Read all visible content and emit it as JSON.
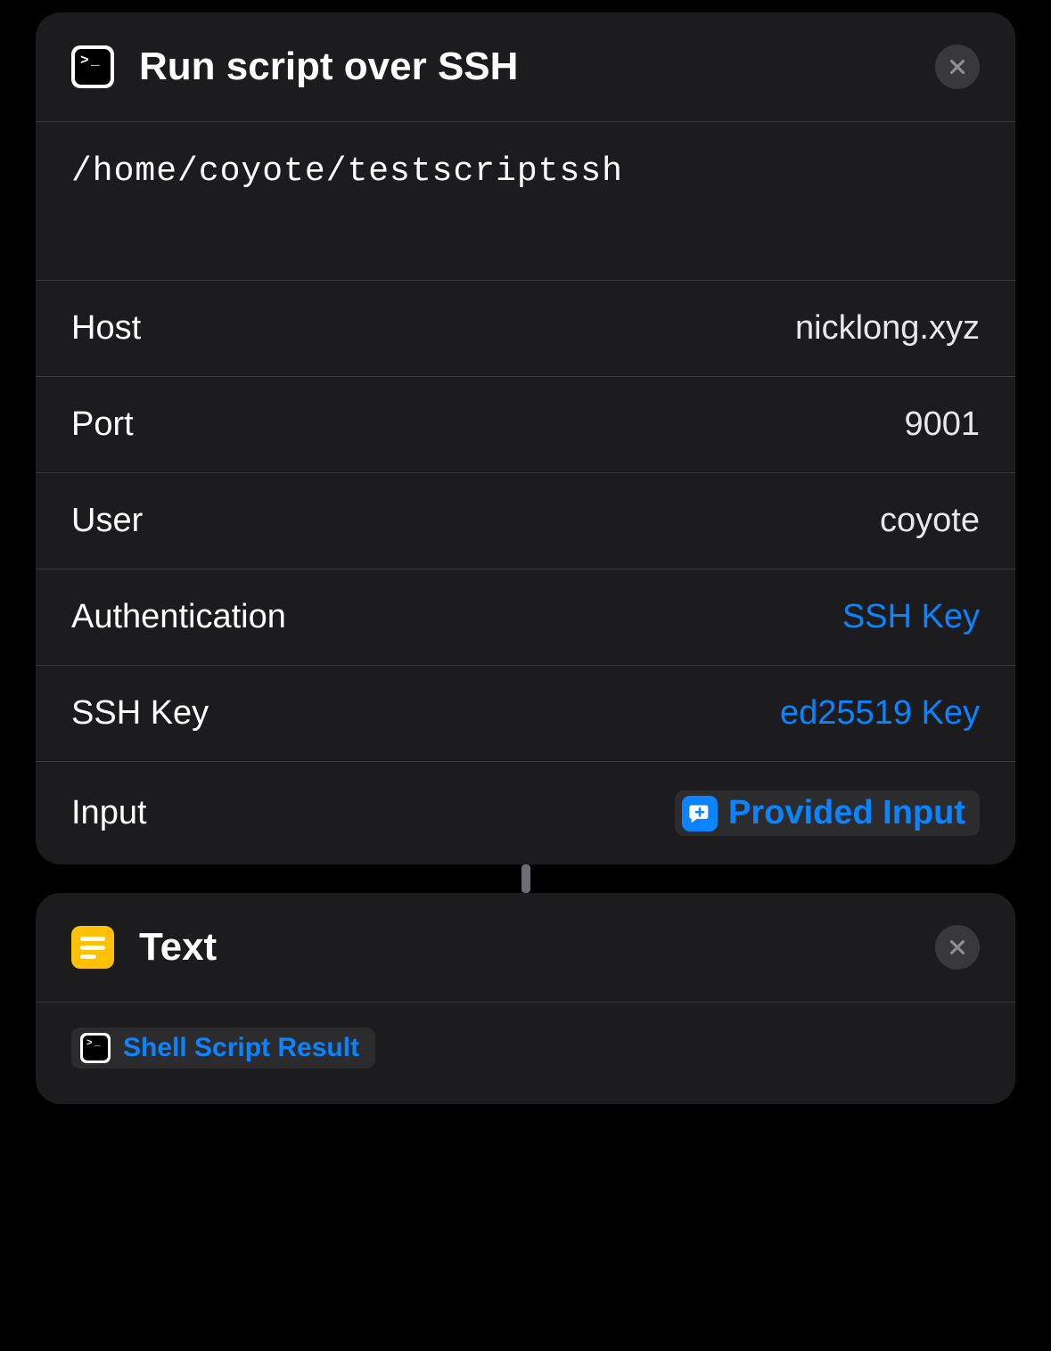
{
  "ssh_action": {
    "title": "Run script over SSH",
    "script": "/home/coyote/testscriptssh",
    "fields": {
      "host": {
        "label": "Host",
        "value": "nicklong.xyz"
      },
      "port": {
        "label": "Port",
        "value": "9001"
      },
      "user": {
        "label": "User",
        "value": "coyote"
      },
      "authentication": {
        "label": "Authentication",
        "value": "SSH Key"
      },
      "ssh_key": {
        "label": "SSH Key",
        "value": "ed25519 Key"
      },
      "input": {
        "label": "Input",
        "value": "Provided Input"
      }
    }
  },
  "text_action": {
    "title": "Text",
    "token": "Shell Script Result"
  }
}
